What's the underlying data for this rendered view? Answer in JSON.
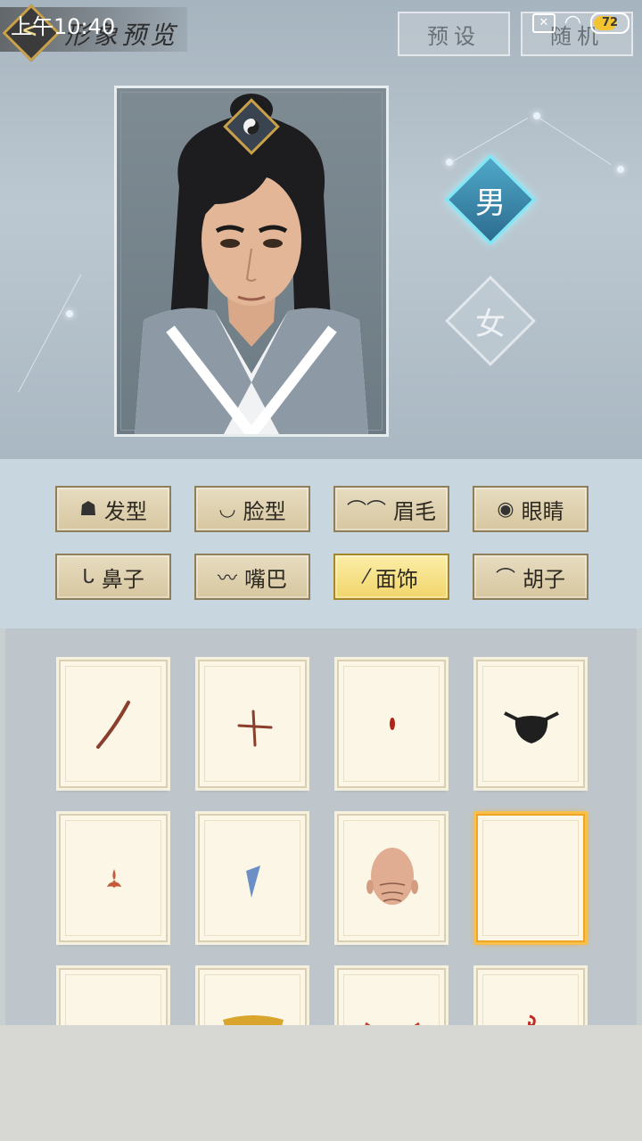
{
  "status_bar": {
    "time": "上午10:40",
    "battery": "72",
    "battery_level": 0.72
  },
  "header": {
    "title": "形象预览",
    "preset_label": "预设",
    "random_label": "随机"
  },
  "gender": {
    "male": "男",
    "female": "女",
    "selected": "male"
  },
  "categories": [
    {
      "label": "发型",
      "icon": "hair-icon"
    },
    {
      "label": "脸型",
      "icon": "face-shape-icon"
    },
    {
      "label": "眉毛",
      "icon": "eyebrow-icon"
    },
    {
      "label": "眼睛",
      "icon": "eye-icon"
    },
    {
      "label": "鼻子",
      "icon": "nose-icon"
    },
    {
      "label": "嘴巴",
      "icon": "mouth-icon"
    },
    {
      "label": "面饰",
      "icon": "face-decoration-icon",
      "active": true
    },
    {
      "label": "胡子",
      "icon": "beard-icon"
    }
  ],
  "items": [
    {
      "icon": "slash-scar-icon"
    },
    {
      "icon": "cross-scar-icon"
    },
    {
      "icon": "red-dot-icon"
    },
    {
      "icon": "eyepatch-icon"
    },
    {
      "icon": "flame-mark-icon"
    },
    {
      "icon": "blue-tear-icon"
    },
    {
      "icon": "bald-head-icon"
    },
    {
      "icon": "empty-slot",
      "selected": true
    },
    {
      "icon": "empty-slot"
    },
    {
      "icon": "gold-ornament-icon"
    },
    {
      "icon": "red-horns-icon"
    },
    {
      "icon": "red-swirl-icon"
    }
  ],
  "colors": {
    "accent_gold": "#f2d56b",
    "selected_orange": "#f0a524",
    "male_cyan": "#7fe8f6"
  }
}
